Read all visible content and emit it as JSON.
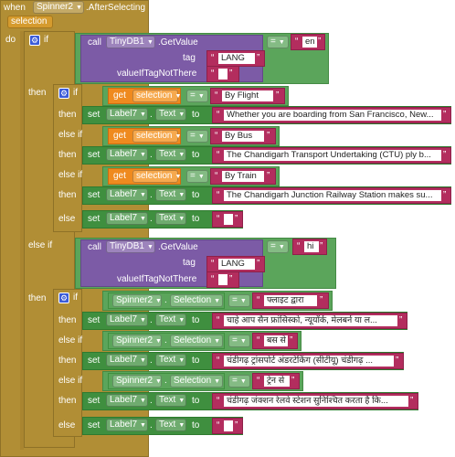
{
  "event": {
    "when": "when",
    "component": "Spinner2",
    "event_name": ".AfterSelecting",
    "param": "selection",
    "do": "do"
  },
  "kw": {
    "if": "if",
    "then": "then",
    "else_if": "else if",
    "else": "else",
    "call": "call",
    "set": "set",
    "to": "to",
    "get": "get",
    "tag": "tag",
    "value_if": "valueIfTagNotThere",
    "eq": "=",
    "dot": "."
  },
  "tinydb": {
    "component": "TinyDB1",
    "method": ".GetValue"
  },
  "outer1": {
    "tag_value": "LANG",
    "lang": "en"
  },
  "outer2": {
    "tag_value": "LANG",
    "lang": "hi"
  },
  "label_comp": "Label7",
  "label_prop": "Text",
  "spinner_comp": "Spinner2",
  "spinner_prop": "Selection",
  "get_var": "selection",
  "en_rows": [
    {
      "kind": "if",
      "match": "By Flight",
      "text": "Whether you are boarding from San Francisco, New..."
    },
    {
      "kind": "else if",
      "match": "By Bus",
      "text": "The Chandigarh Transport Undertaking (CTU) ply b..."
    },
    {
      "kind": "else if",
      "match": "By Train",
      "text": "The Chandigarh Junction Railway Station makes su..."
    }
  ],
  "hi_rows": [
    {
      "kind": "if",
      "match": "फ्लाइट द्वारा",
      "text": "चाहे आप सैन फ्रांसिस्को, न्यूयॉर्क, मेलबर्न या ल..."
    },
    {
      "kind": "else if",
      "match": "बस से",
      "text": "चंडीगढ़ ट्रांसपोर्ट अंडरटेकिंग (सीटीयू) चंडीगढ़ ..."
    },
    {
      "kind": "else if",
      "match": "ट्रेन से",
      "text": "चंडीगढ़ जंक्शन रेलवे स्टेशन सुनिश्चित करता है कि..."
    }
  ],
  "icons": {
    "mutator": "gear-icon",
    "dropdown": "dropdown-arrow-icon"
  }
}
